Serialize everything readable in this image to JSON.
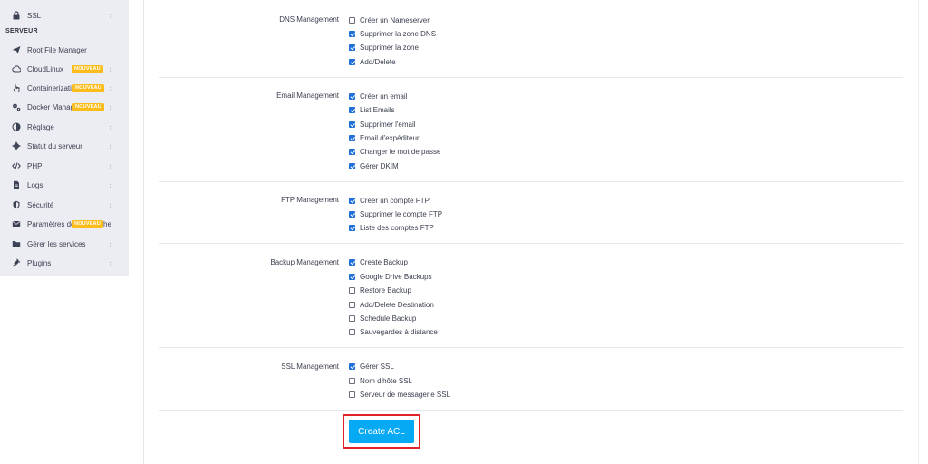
{
  "sidebar": {
    "section_label": "SERVEUR",
    "items": [
      {
        "label": "SSL",
        "icon": "lock-icon",
        "badge": ""
      },
      {
        "label": "Root File Manager",
        "icon": "paper-plane-icon",
        "badge": ""
      },
      {
        "label": "CloudLinux",
        "icon": "cloud-icon",
        "badge": "NOUVEAU"
      },
      {
        "label": "Containerizatio",
        "icon": "pointer-hand-icon",
        "badge": "NOUVEAU"
      },
      {
        "label": "Docker Manag",
        "icon": "cogs-icon",
        "badge": "NOUVEAU"
      },
      {
        "label": "Réglage",
        "icon": "half-circle-icon",
        "badge": ""
      },
      {
        "label": "Statut du serveur",
        "icon": "gear-icon",
        "badge": ""
      },
      {
        "label": "PHP",
        "icon": "code-icon",
        "badge": ""
      },
      {
        "label": "Logs",
        "icon": "file-icon",
        "badge": ""
      },
      {
        "label": "Sécurité",
        "icon": "shield-icon",
        "badge": ""
      },
      {
        "label": "Paramètres de",
        "label_tail": "he",
        "icon": "envelope-icon",
        "badge": "NOUVEAU"
      },
      {
        "label": "Gérer les services",
        "icon": "folder-icon",
        "badge": ""
      },
      {
        "label": "Plugins",
        "icon": "plug-icon",
        "badge": ""
      }
    ],
    "chevron": "›",
    "badge_color": "#fbbd1c"
  },
  "sections": [
    {
      "title": "DNS Management",
      "options": [
        {
          "label": "Créer un Nameserver",
          "checked": false
        },
        {
          "label": "Supprimer la zone DNS",
          "checked": true
        },
        {
          "label": "Supprimer la zone",
          "checked": true
        },
        {
          "label": "Add/Delete",
          "checked": true
        }
      ]
    },
    {
      "title": "Email Management",
      "options": [
        {
          "label": "Créer un email",
          "checked": true
        },
        {
          "label": "List Emails",
          "checked": true
        },
        {
          "label": "Supprimer l'email",
          "checked": true
        },
        {
          "label": "Email d'expéditeur",
          "checked": true
        },
        {
          "label": "Changer le mot de passe",
          "checked": true
        },
        {
          "label": "Gérer DKIM",
          "checked": true
        }
      ]
    },
    {
      "title": "FTP Management",
      "options": [
        {
          "label": "Créer un compte FTP",
          "checked": true
        },
        {
          "label": "Supprimer le compte FTP",
          "checked": true
        },
        {
          "label": "Liste des comptes FTP",
          "checked": true
        }
      ]
    },
    {
      "title": "Backup Management",
      "options": [
        {
          "label": "Create Backup",
          "checked": true
        },
        {
          "label": "Google Drive Backups",
          "checked": true
        },
        {
          "label": "Restore Backup",
          "checked": false
        },
        {
          "label": "Add/Delete Destination",
          "checked": false
        },
        {
          "label": "Schedule Backup",
          "checked": false
        },
        {
          "label": "Sauvegardes à distance",
          "checked": false
        }
      ]
    },
    {
      "title": "SSL Management",
      "options": [
        {
          "label": "Gérer SSL",
          "checked": true
        },
        {
          "label": "Nom d'hôte SSL",
          "checked": false
        },
        {
          "label": "Serveur de messagerie SSL",
          "checked": false
        }
      ]
    }
  ],
  "submit": {
    "label": "Create ACL",
    "color": "#06a9f4",
    "highlight_color": "#e0232b"
  }
}
